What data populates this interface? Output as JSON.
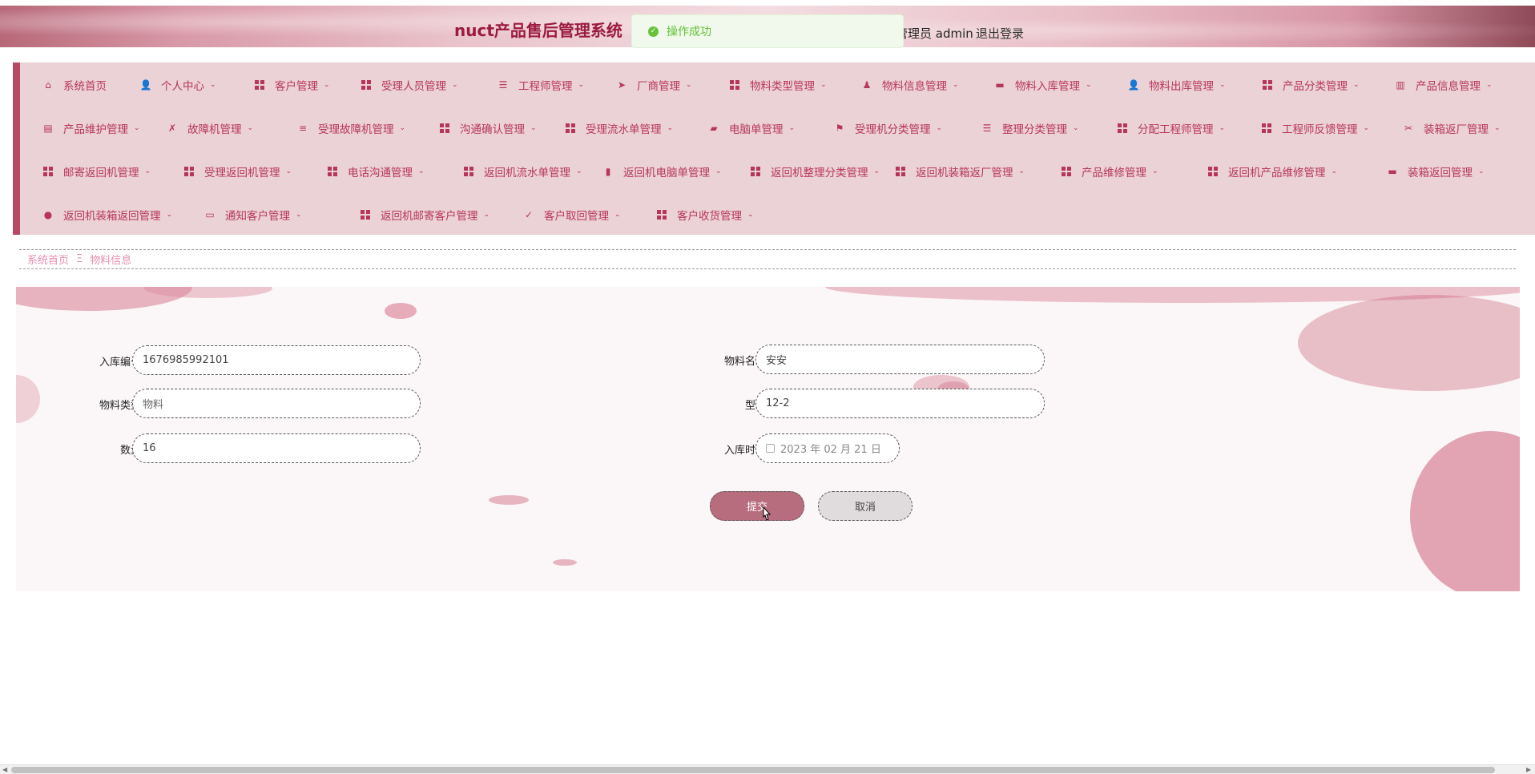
{
  "header": {
    "title": "nuct产品售后管理系统",
    "user_label": "管理员 admin",
    "logout_label": "退出登录"
  },
  "toast": {
    "message": "操作成功",
    "icon": "success-check-icon",
    "color": "#67c23a"
  },
  "nav": {
    "rows": [
      [
        {
          "label": "系统首页",
          "icon": "home-icon",
          "chevron": false
        },
        {
          "label": "个人中心",
          "icon": "user-icon",
          "chevron": true
        },
        {
          "label": "客户管理",
          "icon": "grid-icon",
          "chevron": true
        },
        {
          "label": "受理人员管理",
          "icon": "grid-icon",
          "chevron": true
        },
        {
          "label": "工程师管理",
          "icon": "list-icon",
          "chevron": true
        },
        {
          "label": "厂商管理",
          "icon": "send-icon",
          "chevron": true
        },
        {
          "label": "物料类型管理",
          "icon": "grid-icon",
          "chevron": true
        },
        {
          "label": "物料信息管理",
          "icon": "user-tie-icon",
          "chevron": true
        },
        {
          "label": "物料入库管理",
          "icon": "printer-icon",
          "chevron": true
        },
        {
          "label": "物料出库管理",
          "icon": "user-icon",
          "chevron": true
        },
        {
          "label": "产品分类管理",
          "icon": "grid-icon",
          "chevron": true
        },
        {
          "label": "产品信息管理",
          "icon": "building-icon",
          "chevron": true
        }
      ],
      [
        {
          "label": "产品维护管理",
          "icon": "clipboard-icon",
          "chevron": true
        },
        {
          "label": "故障机管理",
          "icon": "clipboard-x-icon",
          "chevron": true
        },
        {
          "label": "受理故障机管理",
          "icon": "sliders-icon",
          "chevron": true
        },
        {
          "label": "沟通确认管理",
          "icon": "grid-icon",
          "chevron": true
        },
        {
          "label": "受理流水单管理",
          "icon": "grid-icon",
          "chevron": true
        },
        {
          "label": "电脑单管理",
          "icon": "briefcase-icon",
          "chevron": true
        },
        {
          "label": "受理机分类管理",
          "icon": "flag-icon",
          "chevron": true
        },
        {
          "label": "整理分类管理",
          "icon": "list-icon",
          "chevron": true
        },
        {
          "label": "分配工程师管理",
          "icon": "grid-icon",
          "chevron": true
        },
        {
          "label": "工程师反馈管理",
          "icon": "grid-icon",
          "chevron": true
        },
        {
          "label": "装箱返厂管理",
          "icon": "bandage-icon",
          "chevron": true
        }
      ],
      [
        {
          "label": "邮寄返回机管理",
          "icon": "grid-icon",
          "chevron": true
        },
        {
          "label": "受理返回机管理",
          "icon": "grid-icon",
          "chevron": true
        },
        {
          "label": "电话沟通管理",
          "icon": "grid-icon",
          "chevron": true
        },
        {
          "label": "返回机流水单管理",
          "icon": "grid-icon",
          "chevron": true
        },
        {
          "label": "返回机电脑单管理",
          "icon": "bar-chart-icon",
          "chevron": true
        },
        {
          "label": "返回机整理分类管理",
          "icon": "grid-icon",
          "chevron": true
        },
        {
          "label": "返回机装箱返厂管理",
          "icon": "grid-icon",
          "chevron": true
        },
        {
          "label": "产品维修管理",
          "icon": "grid-icon",
          "chevron": true
        },
        {
          "label": "返回机产品维修管理",
          "icon": "grid-icon",
          "chevron": true
        },
        {
          "label": "装箱返回管理",
          "icon": "toolbox-icon",
          "chevron": true
        }
      ],
      [
        {
          "label": "返回机装箱返回管理",
          "icon": "map-pin-icon",
          "chevron": true
        },
        {
          "label": "通知客户管理",
          "icon": "monitor-icon",
          "chevron": true
        },
        {
          "label": "返回机邮寄客户管理",
          "icon": "grid-icon",
          "chevron": true
        },
        {
          "label": "客户取回管理",
          "icon": "clipboard-check-icon",
          "chevron": true
        },
        {
          "label": "客户收货管理",
          "icon": "grid-icon",
          "chevron": true
        }
      ]
    ]
  },
  "breadcrumb": {
    "home": "系统首页",
    "separator": "Ξ",
    "current": "物料信息"
  },
  "form": {
    "entry_no": {
      "label": "入库编号",
      "value": "1676985992101"
    },
    "material_type": {
      "label": "物料类型",
      "value": "物料"
    },
    "quantity": {
      "label": "数量",
      "value": "16"
    },
    "material_name": {
      "label": "物料名称",
      "value": "安安"
    },
    "model": {
      "label": "型号",
      "value": "12-2"
    },
    "entry_time": {
      "label": "入库时间",
      "value": "2023 年 02 月 21 日"
    },
    "submit_label": "提交",
    "cancel_label": "取消"
  },
  "colors": {
    "accent": "#b8355a",
    "nav_bg": "#ead2d6",
    "submit_bg": "#b86d7e",
    "title": "#9b1a3f"
  }
}
